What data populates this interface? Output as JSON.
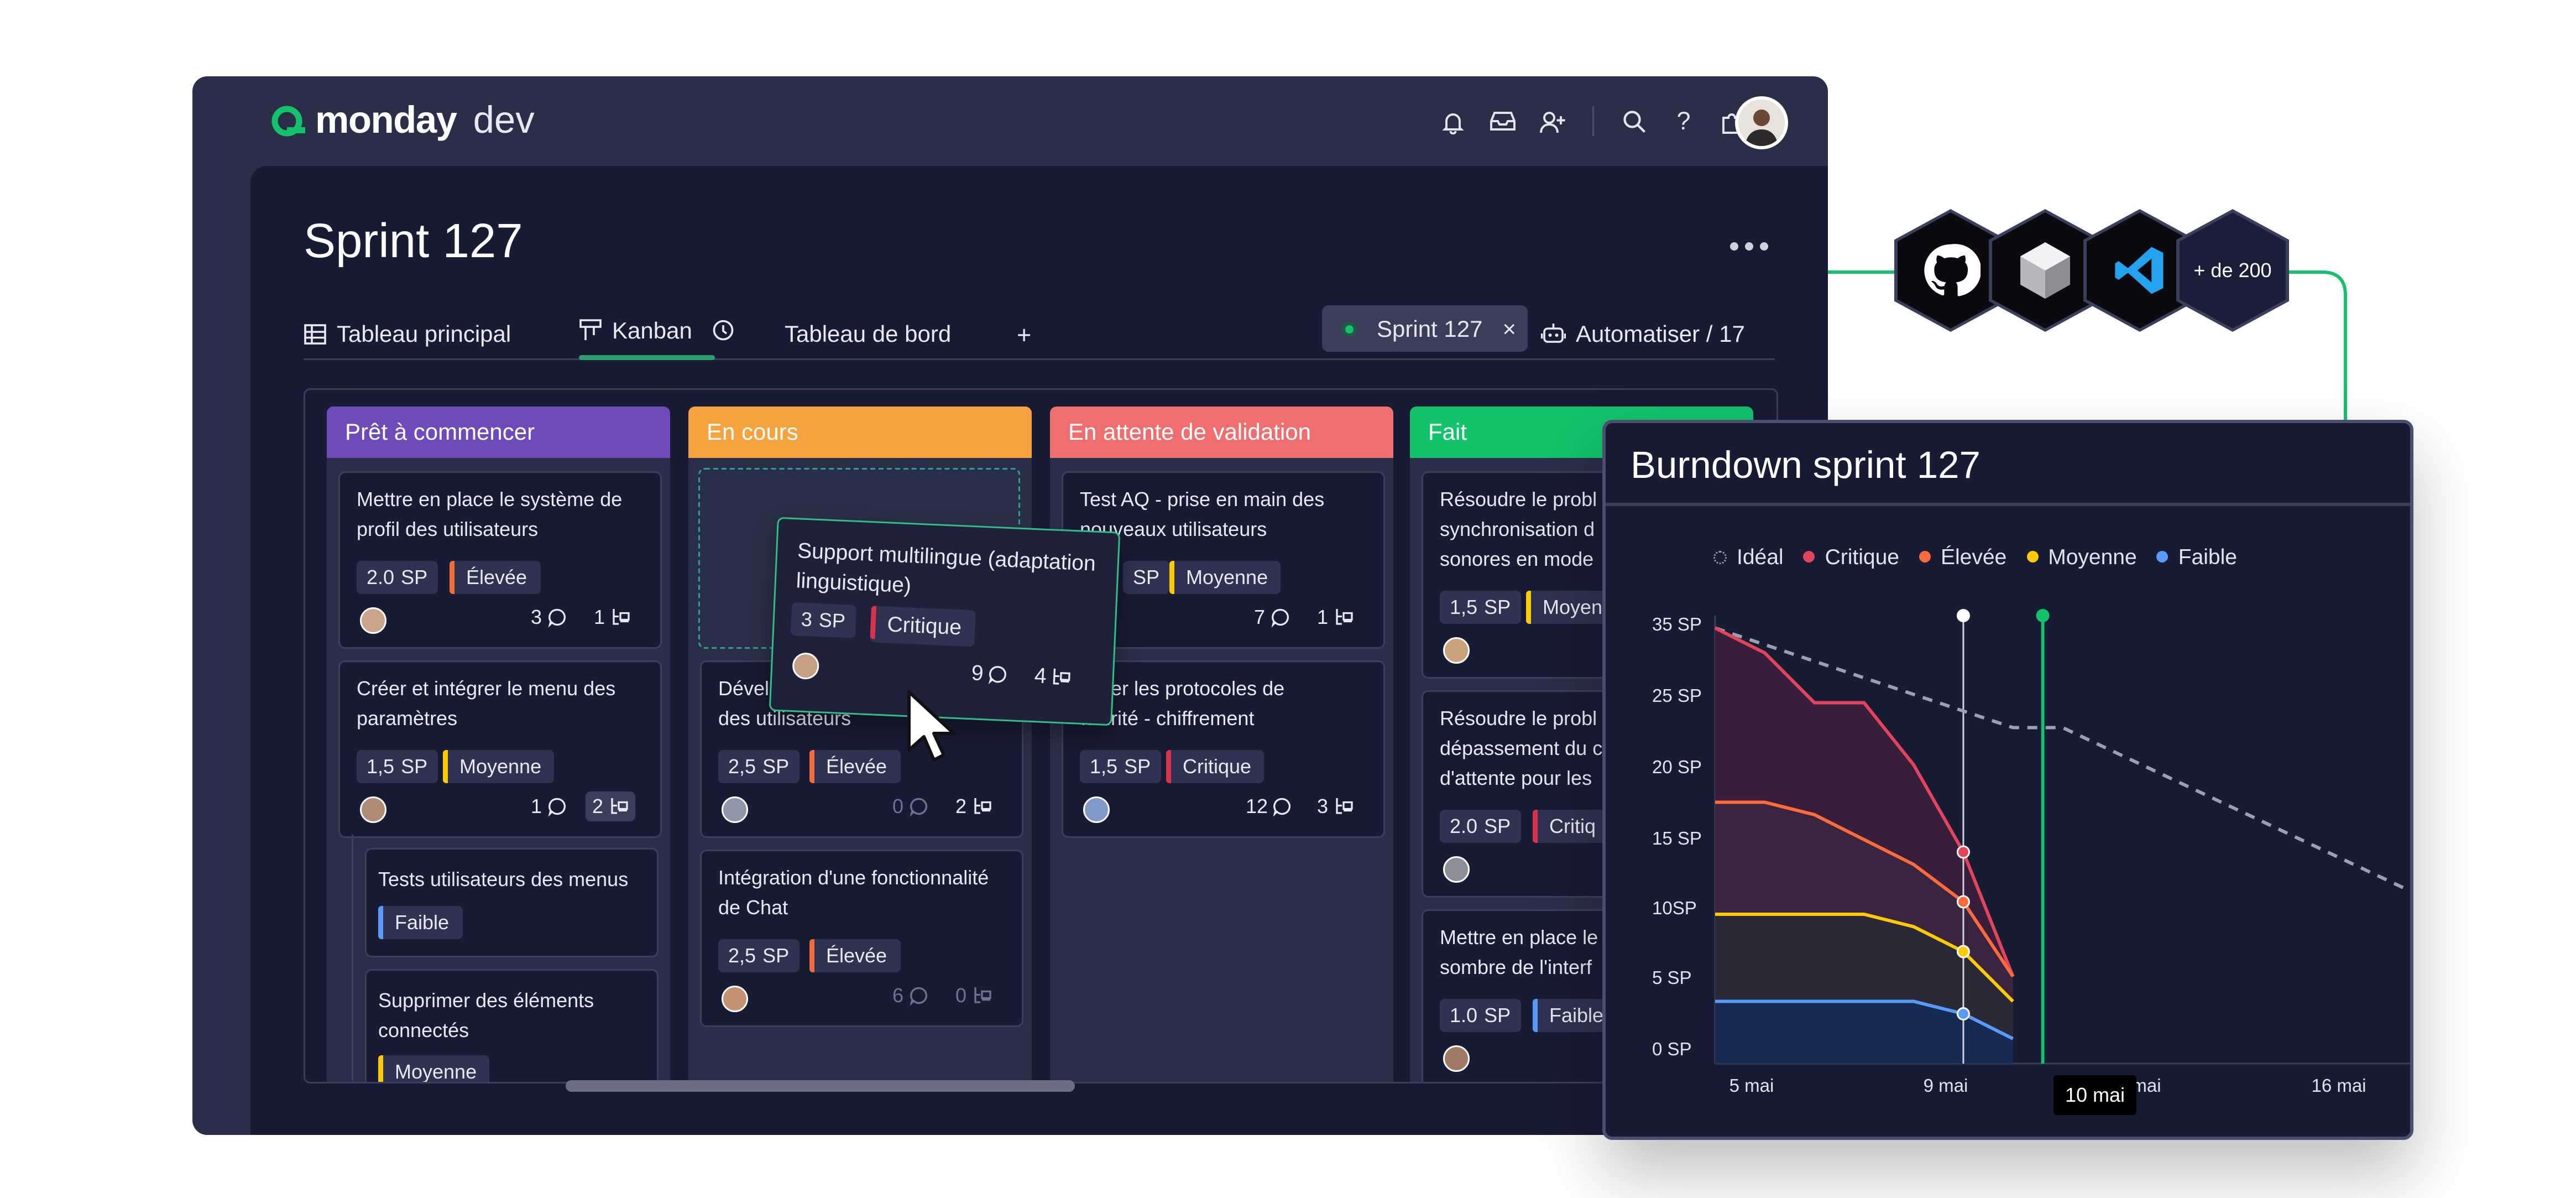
{
  "app": {
    "logo_brand": "monday",
    "logo_product": "dev",
    "page_title": "Sprint 127",
    "tabs": {
      "main_table": "Tableau principal",
      "kanban": "Kanban",
      "dashboard": "Tableau de bord",
      "add": "+"
    },
    "sprint_filter": "Sprint 127",
    "sprint_filter_clear": "×",
    "automate": "Automatiser / 17",
    "topbar_icons": [
      "bell-icon",
      "inbox-icon",
      "invite-user-icon",
      "search-icon",
      "help-icon",
      "apps-icon"
    ]
  },
  "columns": [
    {
      "title": "Prêt à commencer",
      "color": "#6e4bb8"
    },
    {
      "title": "En cours",
      "color": "#f5a33f"
    },
    {
      "title": "En attente de validation",
      "color": "#ef6f70"
    },
    {
      "title": "Fait",
      "color": "#13c26b"
    }
  ],
  "cards": {
    "c1": {
      "title": "Mettre en place le système de profil des utilisateurs",
      "sp": "2.0",
      "sp_unit": "SP",
      "priority": "Élevée",
      "comments": "3",
      "subitems": "1"
    },
    "c2": {
      "title": "Créer et intégrer le menu des paramètres",
      "sp": "1,5",
      "sp_unit": "SP",
      "priority": "Moyenne",
      "comments": "1",
      "subitems": "2"
    },
    "c2a": {
      "title": "Tests utilisateurs des menus",
      "priority": "Faible"
    },
    "c2b": {
      "title": "Supprimer des éléments connectés",
      "priority": "Moyenne"
    },
    "c3": {
      "title": "Dével… des utilisateurs",
      "title_a": "Dével",
      "title_b": "des utilisateurs",
      "sp": "2,5",
      "sp_unit": "SP",
      "priority": "Élevée",
      "comments": "0",
      "subitems": "2"
    },
    "c4": {
      "title": "Intégration d'une fonctionnalité de Chat",
      "sp": "2,5",
      "sp_unit": "SP",
      "priority": "Élevée",
      "comments": "6",
      "subitems": "0"
    },
    "c5": {
      "title": "Test AQ - prise en main des nouveaux utilisateurs",
      "sp_unit": "SP",
      "priority": "Moyenne",
      "comments": "7",
      "subitems": "1"
    },
    "c6": {
      "title_a": "…der les protocoles de",
      "title_b": "…urité - chiffrement",
      "sp": "1,5",
      "sp_unit": "SP",
      "priority": "Critique",
      "comments": "12",
      "subitems": "3"
    },
    "c7": {
      "title_a": "Résoudre le probl",
      "title_b": "synchronisation d",
      "title_c": "sonores en mode",
      "sp": "1,5",
      "sp_unit": "SP",
      "priority": "Moyen"
    },
    "c8": {
      "title_a": "Résoudre le probl",
      "title_b": "dépassement du c",
      "title_c": "d'attente pour les",
      "sp": "2.0",
      "sp_unit": "SP",
      "priority": "Critiq"
    },
    "c9": {
      "title_a": "Mettre en place le",
      "title_b": "sombre de l'interf",
      "sp": "1.0",
      "sp_unit": "SP",
      "priority": "Faible"
    }
  },
  "drag_card": {
    "title": "Support multilingue (adaptation linguistique)",
    "sp": "3",
    "sp_unit": "SP",
    "priority": "Critique",
    "comments": "9",
    "subitems": "4"
  },
  "priority_colors": {
    "Élevée": "#f26b3a",
    "Moyenne": "#ffcb00",
    "Critique": "#d8334a",
    "Faible": "#579bfc"
  },
  "integrations": {
    "icons": [
      "github-icon",
      "unity-icon",
      "vscode-icon"
    ],
    "more": "+ de 200"
  },
  "burndown": {
    "title": "Burndown sprint 127",
    "tooltip": "10 mai",
    "chart_data": {
      "type": "area",
      "legend_placement": "top",
      "y_ticks": [
        "35 SP",
        "25 SP",
        "20 SP",
        "15 SP",
        "10SP",
        "5 SP",
        "0 SP"
      ],
      "y_tick_values": [
        35,
        25,
        20,
        15,
        10,
        5,
        0
      ],
      "x_ticks": [
        "5 mai",
        "9 mai",
        "mai",
        "16 mai"
      ],
      "x_tick_days": [
        5,
        9,
        11,
        17
      ],
      "xlim_days": [
        5,
        19
      ],
      "ylim": [
        0,
        36
      ],
      "marker_day": 10,
      "series": [
        {
          "name": "Idéal",
          "color": "#9aa0b4",
          "dashed": true,
          "x": [
            5,
            8,
            11,
            12,
            20
          ],
          "y": [
            35,
            31,
            27,
            27,
            12
          ]
        },
        {
          "name": "Critique",
          "color": "#e2445c",
          "x": [
            5,
            6,
            7,
            8,
            9,
            10,
            11
          ],
          "y": [
            35,
            33,
            29,
            29,
            24,
            17,
            7
          ]
        },
        {
          "name": "Élevée",
          "color": "#ff6b3b",
          "x": [
            5,
            6,
            7,
            8,
            9,
            10,
            11
          ],
          "y": [
            21,
            21,
            20,
            18,
            16,
            13,
            7
          ]
        },
        {
          "name": "Moyenne",
          "color": "#ffcb00",
          "x": [
            5,
            6,
            7,
            8,
            9,
            10,
            11
          ],
          "y": [
            12,
            12,
            12,
            12,
            11,
            9,
            5
          ]
        },
        {
          "name": "Faible",
          "color": "#579bfc",
          "x": [
            5,
            6,
            7,
            8,
            9,
            10,
            11
          ],
          "y": [
            5,
            5,
            5,
            5,
            5,
            4,
            2
          ]
        }
      ]
    }
  }
}
